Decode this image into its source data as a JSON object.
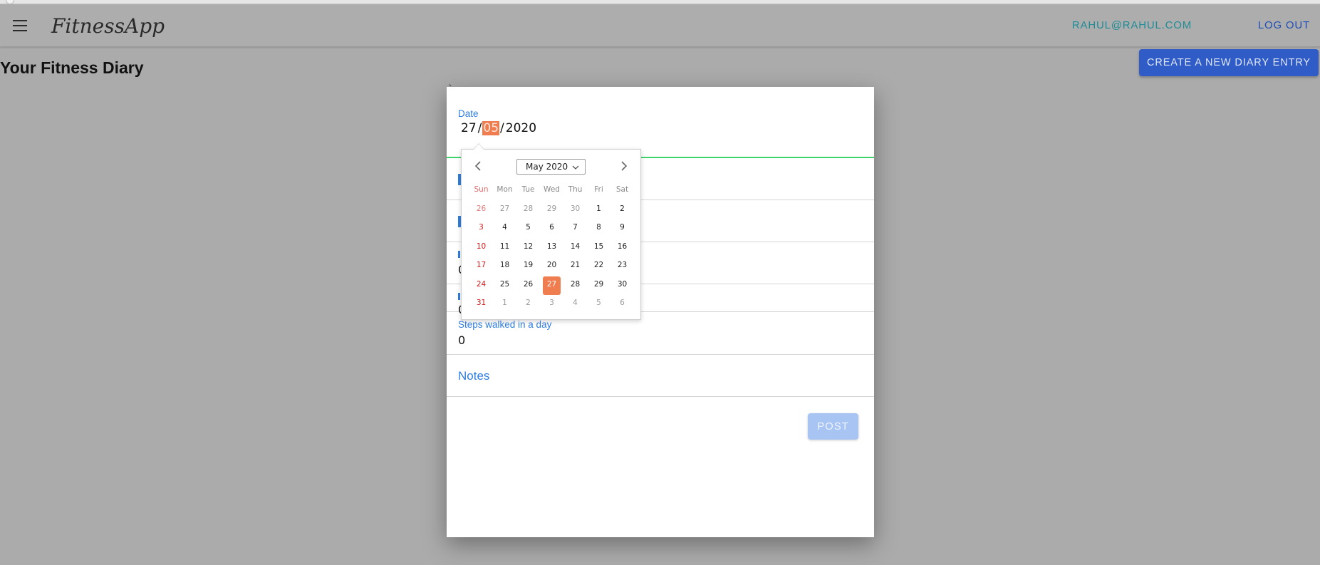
{
  "app": {
    "name": "FitnessApp"
  },
  "header": {
    "user_email": "RAHUL@RAHUL.COM",
    "logout_label": "LOG OUT"
  },
  "page": {
    "title": "Your Fitness Diary",
    "create_button": "CREATE A NEW DIARY ENTRY"
  },
  "dialog": {
    "backtick": "`",
    "date_label": "Date",
    "date_value": {
      "day": "27",
      "month": "05",
      "year": "2020",
      "separator": "/"
    },
    "hidden_fields": [
      {
        "partial": ""
      },
      {
        "partial": ""
      },
      {
        "partial": "0"
      },
      {
        "partial": "0"
      }
    ],
    "steps_label": "Steps walked in a day",
    "steps_value": "0",
    "notes_label": "Notes",
    "post_label": "POST"
  },
  "calendar": {
    "month_label": "May 2020",
    "weekdays": [
      "Sun",
      "Mon",
      "Tue",
      "Wed",
      "Thu",
      "Fri",
      "Sat"
    ],
    "weeks": [
      [
        "26",
        "27",
        "28",
        "29",
        "30",
        "1",
        "2"
      ],
      [
        "3",
        "4",
        "5",
        "6",
        "7",
        "8",
        "9"
      ],
      [
        "10",
        "11",
        "12",
        "13",
        "14",
        "15",
        "16"
      ],
      [
        "17",
        "18",
        "19",
        "20",
        "21",
        "22",
        "23"
      ],
      [
        "24",
        "25",
        "26",
        "27",
        "28",
        "29",
        "30"
      ],
      [
        "31",
        "1",
        "2",
        "3",
        "4",
        "5",
        "6"
      ]
    ],
    "selected": "27"
  },
  "colors": {
    "accent_orange": "#ef7d4f",
    "primary_blue": "#2f5cc7",
    "label_blue": "#2f7de1",
    "focus_green": "#3fd36b",
    "sunday_red": "#d31818"
  },
  "icons": {
    "menu": "hamburger-menu-icon",
    "prev": "chevron-left-icon",
    "next": "chevron-right-icon",
    "dropdown": "chevron-down-icon"
  }
}
